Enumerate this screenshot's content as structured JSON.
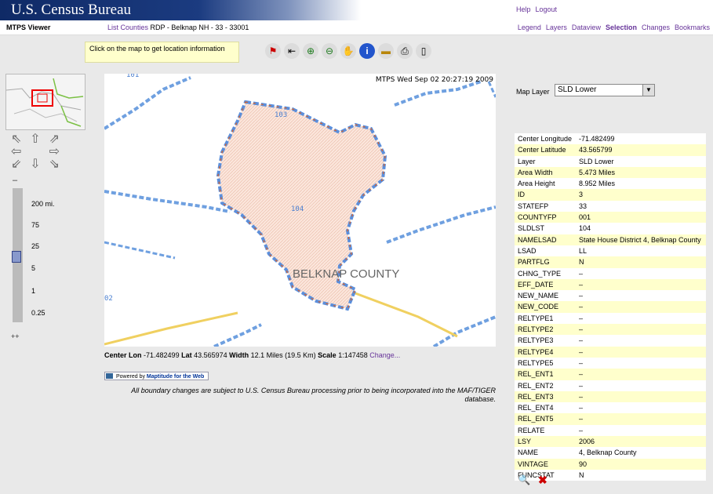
{
  "banner": {
    "title": "U.S. Census Bureau",
    "help": "Help",
    "logout": "Logout"
  },
  "app_name": "MTPS Viewer",
  "crumb": {
    "link": "List Counties",
    "text": "RDP - Belknap NH - 33 - 33001"
  },
  "tabs": [
    "Legend",
    "Layers",
    "Dataview",
    "Selection",
    "Changes",
    "Bookmarks"
  ],
  "info_message": "Click on the map to get location information",
  "toolbar": [
    "identify-icon",
    "back-icon",
    "zoom-in-icon",
    "zoom-out-icon",
    "pan-hand-icon",
    "info-icon",
    "ruler-icon",
    "print-icon",
    "erase-icon"
  ],
  "zoom": {
    "minus": "–",
    "plus": "++",
    "levels": [
      "200 mi.",
      "75",
      "25",
      "5",
      "1",
      "0.25"
    ]
  },
  "map": {
    "stamp": "MTPS Wed Sep 02 20:27:19 2009",
    "label_101": "101",
    "label_103": "103",
    "label_104": "104",
    "label_102": "02",
    "county": "BELKNAP COUNTY"
  },
  "status": {
    "center_lon_label": "Center Lon",
    "center_lon": "-71.482499",
    "lat_label": "Lat",
    "lat": "43.565974",
    "width_label": "Width",
    "width": "12.1 Miles (19.5 Km)",
    "scale_label": "Scale",
    "scale": "1:147458",
    "change": "Change..."
  },
  "powered": {
    "prefix": "Powered by",
    "brand": "Maptitude for the Web"
  },
  "disclaimer": "All boundary changes are subject to U.S. Census Bureau processing prior to being incorporated into the MAF/TIGER database.",
  "map_layer": {
    "label": "Map Layer",
    "value": "SLD Lower"
  },
  "properties": [
    [
      "Center Longitude",
      "-71.482499"
    ],
    [
      "Center Latitude",
      "43.565799"
    ],
    [
      "Layer",
      "SLD Lower"
    ],
    [
      "Area Width",
      "5.473 Miles"
    ],
    [
      "Area Height",
      "8.952 Miles"
    ],
    [
      "ID",
      "3"
    ],
    [
      "STATEFP",
      "33"
    ],
    [
      "COUNTYFP",
      "001"
    ],
    [
      "SLDLST",
      "104"
    ],
    [
      "NAMELSAD",
      "State House District 4, Belknap County"
    ],
    [
      "LSAD",
      "LL"
    ],
    [
      "PARTFLG",
      "N"
    ],
    [
      "CHNG_TYPE",
      "–"
    ],
    [
      "EFF_DATE",
      "–"
    ],
    [
      "NEW_NAME",
      "–"
    ],
    [
      "NEW_CODE",
      "–"
    ],
    [
      "RELTYPE1",
      "–"
    ],
    [
      "RELTYPE2",
      "–"
    ],
    [
      "RELTYPE3",
      "–"
    ],
    [
      "RELTYPE4",
      "–"
    ],
    [
      "RELTYPE5",
      "–"
    ],
    [
      "REL_ENT1",
      "–"
    ],
    [
      "REL_ENT2",
      "–"
    ],
    [
      "REL_ENT3",
      "–"
    ],
    [
      "REL_ENT4",
      "–"
    ],
    [
      "REL_ENT5",
      "–"
    ],
    [
      "RELATE",
      "–"
    ],
    [
      "LSY",
      "2006"
    ],
    [
      "NAME",
      "4, Belknap County"
    ],
    [
      "VINTAGE",
      "90"
    ],
    [
      "FUNCSTAT",
      "N"
    ]
  ]
}
